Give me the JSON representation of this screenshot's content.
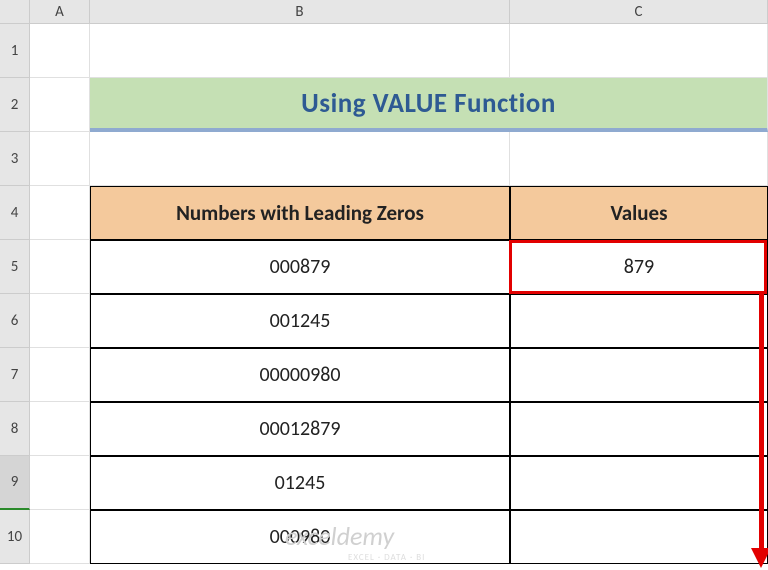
{
  "cols": [
    "A",
    "B",
    "C"
  ],
  "rows": [
    "1",
    "2",
    "3",
    "4",
    "5",
    "6",
    "7",
    "8",
    "9",
    "10"
  ],
  "title": "Using VALUE Function",
  "headers": {
    "b": "Numbers with Leading Zeros",
    "c": "Values"
  },
  "data": {
    "b5": "000879",
    "c5": "879",
    "b6": "001245",
    "b7": "00000980",
    "b8": "00012879",
    "b9": "01245",
    "b10": "000980"
  },
  "watermark": {
    "main": "exceldemy",
    "sub": "EXCEL · DATA · BI"
  }
}
